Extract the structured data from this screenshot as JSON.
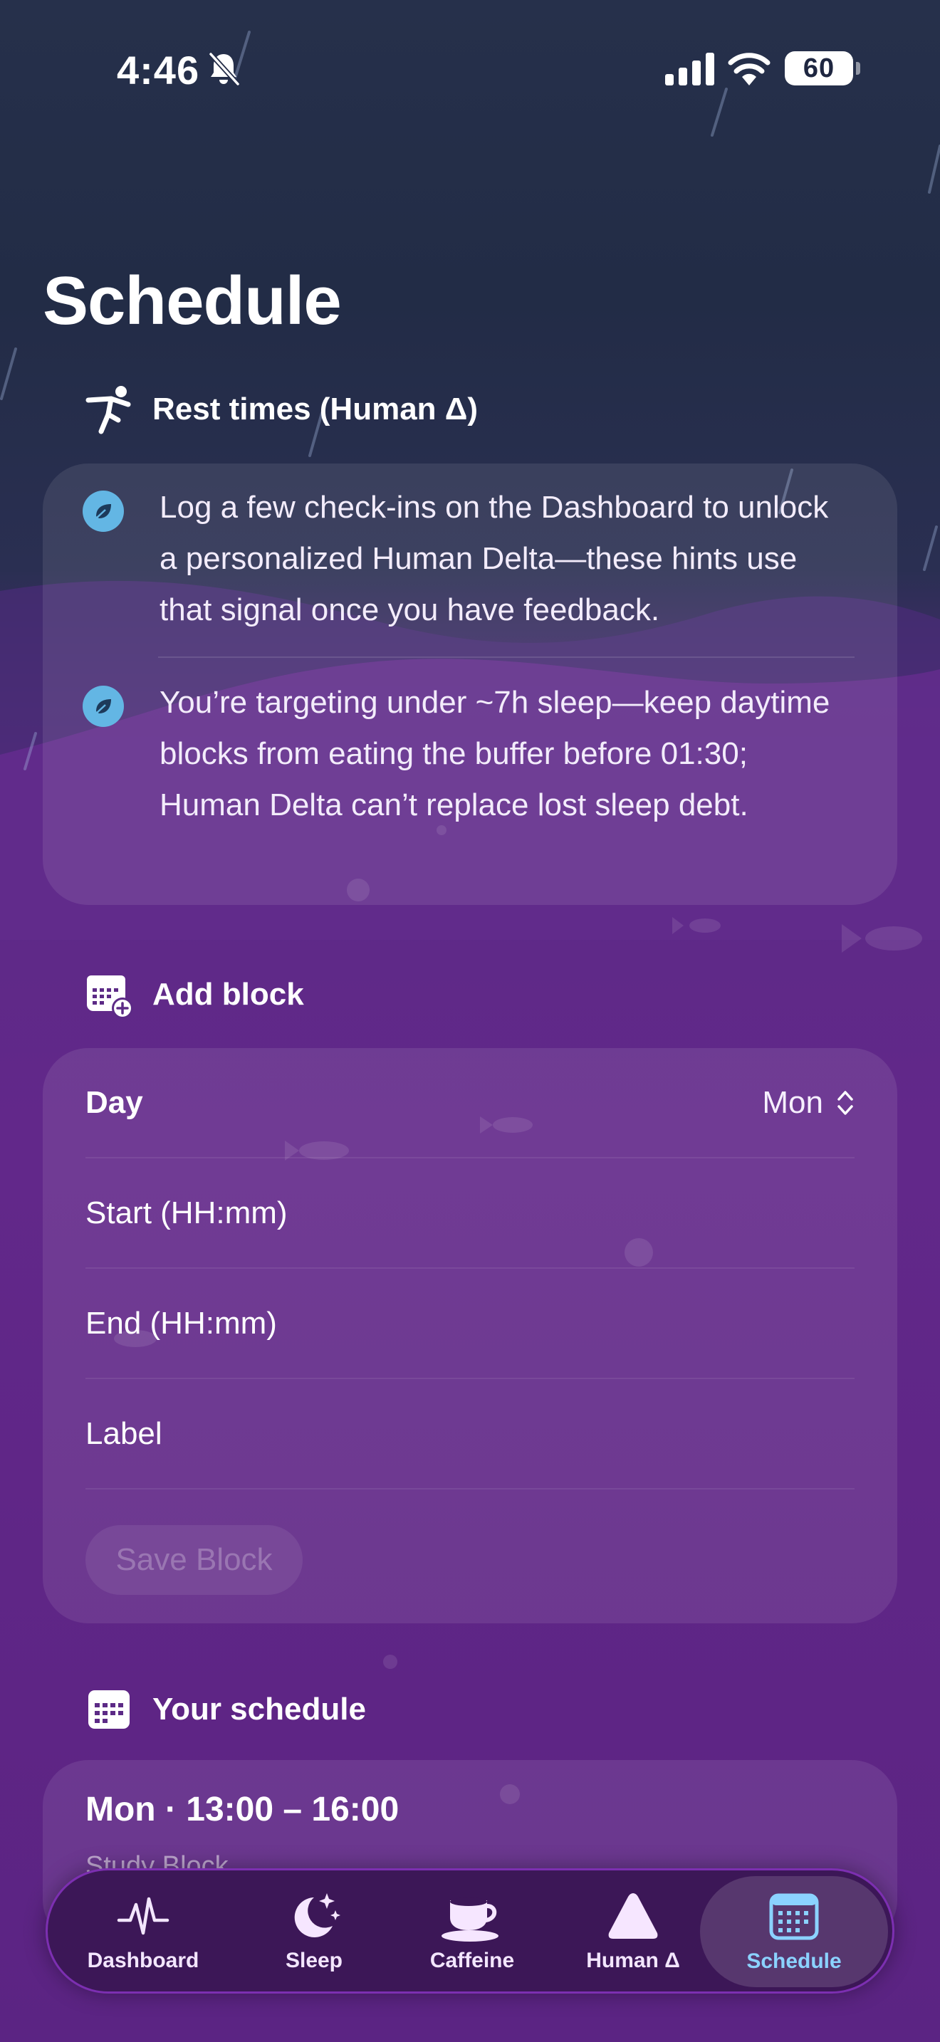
{
  "status_bar": {
    "time": "4:46",
    "battery": "60"
  },
  "page_title": "Schedule",
  "rest_times": {
    "heading": "Rest times (Human Δ)",
    "hints": [
      "Log a few check-ins on the Dashboard to unlock a personalized Human Delta—these hints use that signal once you have feedback.",
      "You’re targeting under ~7h sleep—keep daytime blocks from eating the buffer before 01:30; Human Delta can’t replace lost sleep debt."
    ]
  },
  "add_block": {
    "heading": "Add block",
    "day_label": "Day",
    "day_value": "Mon",
    "start_label": "Start (HH:mm)",
    "end_label": "End (HH:mm)",
    "label_label": "Label",
    "save_label": "Save Block"
  },
  "your_schedule": {
    "heading": "Your schedule",
    "items": [
      {
        "title": "Mon · 13:00 – 16:00",
        "subtitle": "Study Block"
      }
    ]
  },
  "tabs": [
    {
      "label": "Dashboard",
      "icon": "pulse-icon"
    },
    {
      "label": "Sleep",
      "icon": "moon-stars-icon"
    },
    {
      "label": "Caffeine",
      "icon": "coffee-cup-icon"
    },
    {
      "label": "Human Δ",
      "icon": "triangle-icon"
    },
    {
      "label": "Schedule",
      "icon": "calendar-icon",
      "active": true
    }
  ],
  "colors": {
    "accent": "#8bd2ff",
    "hint_icon": "#63b6e4",
    "tab_border": "#7c2fb1"
  }
}
